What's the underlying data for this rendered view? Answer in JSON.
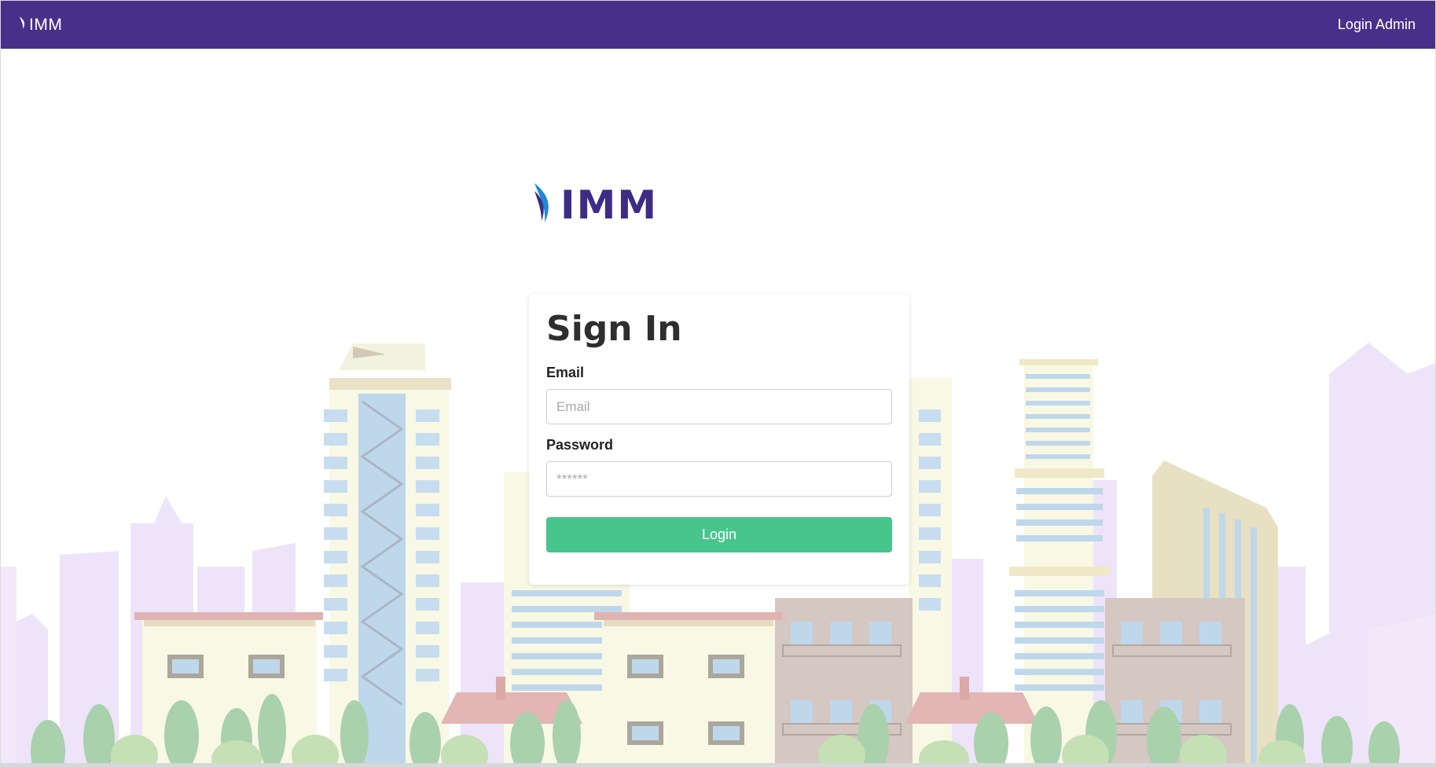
{
  "navbar": {
    "logo_text": "IMM",
    "login_admin_label": "Login Admin",
    "background_color": "#48308a"
  },
  "brand": {
    "logo_text": "IMM",
    "logo_color": "#3e2c84",
    "accent_color": "#1e88d6"
  },
  "signin": {
    "title": "Sign In",
    "email_label": "Email",
    "email_placeholder": "Email",
    "email_value": "",
    "password_label": "Password",
    "password_placeholder": "******",
    "password_value": "",
    "login_label": "Login",
    "login_color": "#48c58d"
  },
  "icons": {
    "nav_logo": "imm-leaf-logo-icon",
    "brand_logo": "imm-leaf-logo-icon"
  }
}
